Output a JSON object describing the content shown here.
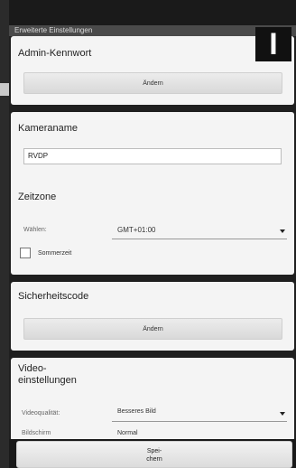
{
  "window": {
    "title": "Erweiterte Einstellungen"
  },
  "admin": {
    "title": "Admin-Kennwort",
    "button": "Ändern"
  },
  "camera": {
    "title": "Kameraname",
    "value": "RVDP"
  },
  "timezone": {
    "title": "Zeitzone",
    "select_label": "Wählen:",
    "selected": "GMT+01:00",
    "dst_label": "Sommerzeit"
  },
  "security": {
    "title": "Sicherheitscode",
    "button": "Ändern"
  },
  "video": {
    "title_line1": "Video-",
    "title_line2": "einstellungen",
    "quality_label": "Videoqualität:",
    "quality_value": "Besseres Bild",
    "screen_label": "Bildschirm",
    "screen_value": "Normal"
  },
  "footer": {
    "save_line1": "Spei-",
    "save_line2": "chern"
  },
  "logo": {
    "text": "I"
  }
}
